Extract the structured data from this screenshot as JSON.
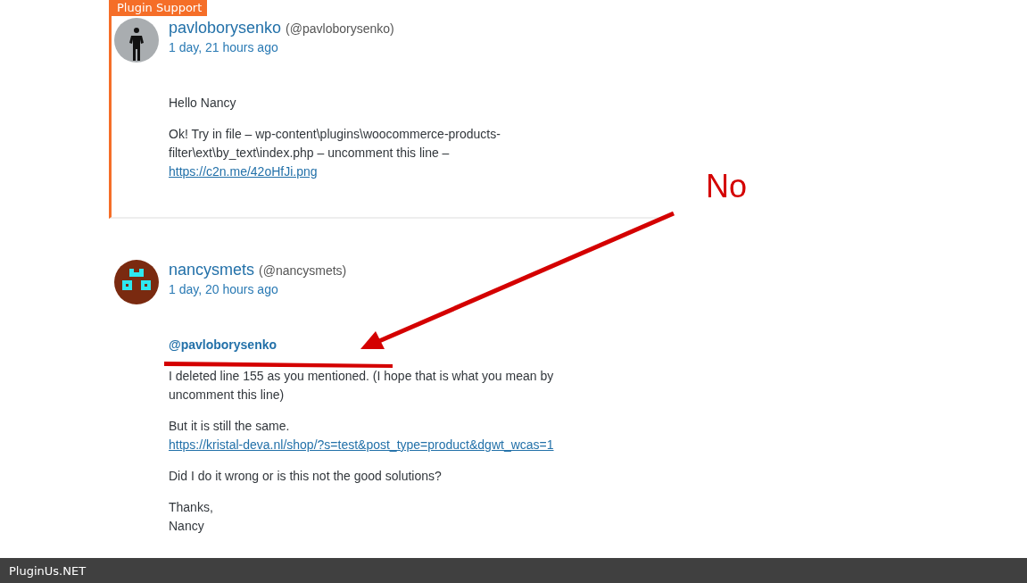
{
  "posts": [
    {
      "badge": "Plugin Support",
      "highlighted": true,
      "avatar": {
        "kind": "photo"
      },
      "author": "pavloborysenko",
      "handle": "(@pavloborysenko)",
      "time": "1 day, 21 hours ago",
      "paragraphs": [
        {
          "parts": [
            {
              "kind": "text",
              "text": "Hello Nancy"
            }
          ]
        },
        {
          "parts": [
            {
              "kind": "text",
              "text": "Ok! Try in file – wp-content\\plugins\\woocommerce-products-filter\\ext\\by_text\\index.php – uncomment this line – "
            },
            {
              "kind": "link",
              "text": "https://c2n.me/42oHfJi.png"
            }
          ]
        }
      ]
    },
    {
      "highlighted": false,
      "avatar": {
        "kind": "identicon"
      },
      "author": "nancysmets",
      "handle": "(@nancysmets)",
      "time": "1 day, 20 hours ago",
      "paragraphs": [
        {
          "parts": [
            {
              "kind": "mention",
              "text": "@pavloborysenko"
            }
          ]
        },
        {
          "parts": [
            {
              "kind": "text",
              "text": "I deleted line 155 as you mentioned. (I hope that is what you mean by uncomment this line)"
            }
          ]
        },
        {
          "parts": [
            {
              "kind": "text",
              "text": "But it is still the same. "
            },
            {
              "kind": "link",
              "text": "https://kristal-deva.nl/shop/?s=test&post_type=product&dgwt_wcas=1"
            }
          ]
        },
        {
          "parts": [
            {
              "kind": "text",
              "text": "Did I do it wrong or is this not the good solutions?"
            }
          ]
        },
        {
          "parts": [
            {
              "kind": "text",
              "text": "Thanks,\nNancy"
            }
          ]
        }
      ]
    }
  ],
  "annotation": {
    "label": "No"
  },
  "footer": {
    "brand": "PluginUs.NET"
  }
}
